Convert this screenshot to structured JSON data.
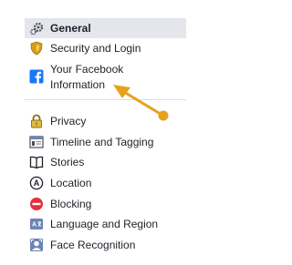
{
  "sidebar": {
    "items": [
      {
        "label": "General",
        "icon": "gear-icon"
      },
      {
        "label": "Security and Login",
        "icon": "shield-icon"
      },
      {
        "label": "Your Facebook Information",
        "icon": "facebook-icon"
      },
      {
        "label": "Privacy",
        "icon": "lock-icon"
      },
      {
        "label": "Timeline and Tagging",
        "icon": "timeline-icon"
      },
      {
        "label": "Stories",
        "icon": "book-icon"
      },
      {
        "label": "Location",
        "icon": "location-icon"
      },
      {
        "label": "Blocking",
        "icon": "blocking-icon"
      },
      {
        "label": "Language and Region",
        "icon": "language-icon"
      },
      {
        "label": "Face Recognition",
        "icon": "face-recognition-icon"
      }
    ]
  },
  "colors": {
    "selected_bg": "#e4e6eb",
    "facebook_blue": "#1877f2",
    "shield_gold": "#d4a017",
    "blocking_red": "#e4303f",
    "arrow_orange": "#e5a21c"
  }
}
